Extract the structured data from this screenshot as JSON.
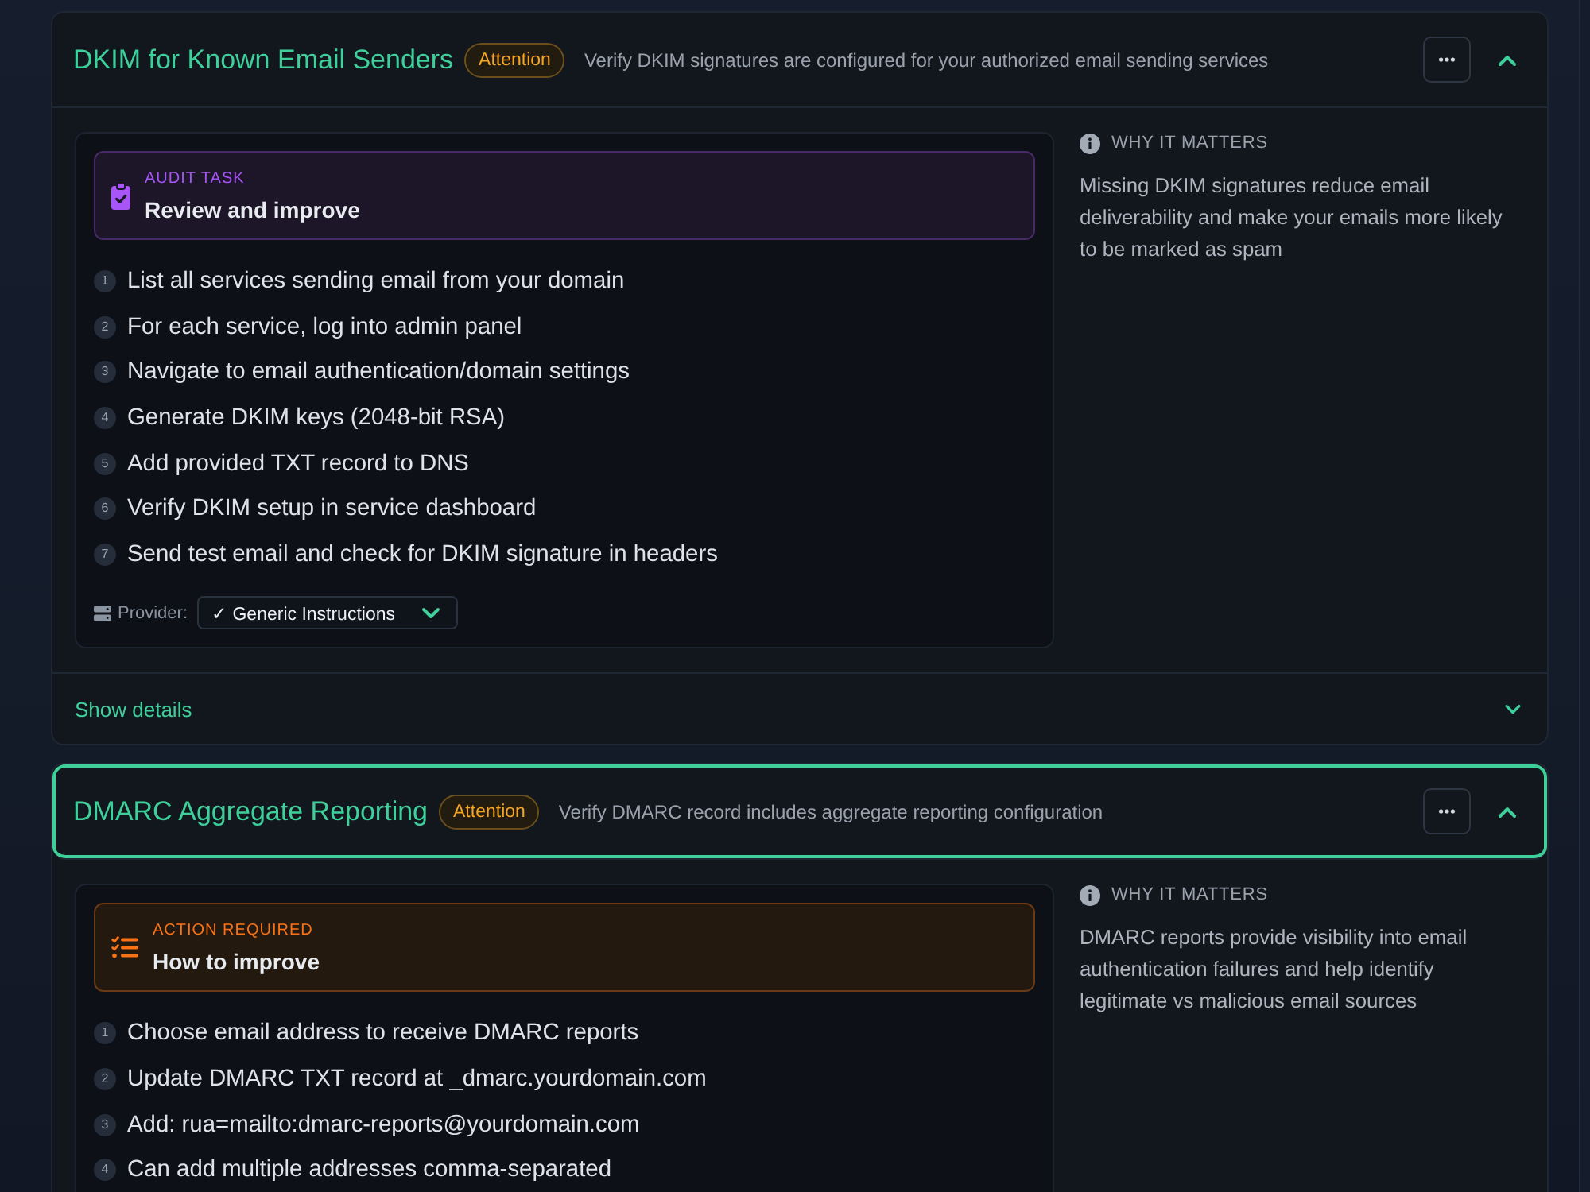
{
  "checks": [
    {
      "title": "DKIM for Known Email Senders",
      "badge": "Attention",
      "description": "Verify DKIM signatures are configured for your authorized email sending services",
      "focused": false,
      "expanded": true,
      "task": {
        "kind": "audit",
        "label": "AUDIT TASK",
        "title": "Review and improve"
      },
      "steps": [
        {
          "number": "1",
          "text": "List all services sending email from your domain"
        },
        {
          "number": "2",
          "text": "For each service, log into admin panel"
        },
        {
          "number": "3",
          "text": "Navigate to email authentication/domain settings"
        },
        {
          "number": "4",
          "text": "Generate DKIM keys (2048-bit RSA)"
        },
        {
          "number": "5",
          "text": "Add provided TXT record to DNS"
        },
        {
          "number": "6",
          "text": "Verify DKIM setup in service dashboard"
        },
        {
          "number": "7",
          "text": "Send test email and check for DKIM signature in headers"
        }
      ],
      "provider": {
        "label": "Provider:",
        "value": "✓ Generic Instructions"
      },
      "why": {
        "heading": "WHY IT MATTERS",
        "text": "Missing DKIM signatures reduce email deliverability and make your emails more likely to be marked as spam"
      },
      "details_link": "Show details"
    },
    {
      "title": "DMARC Aggregate Reporting",
      "badge": "Attention",
      "description": "Verify DMARC record includes aggregate reporting configuration",
      "focused": true,
      "expanded": true,
      "task": {
        "kind": "action",
        "label": "ACTION REQUIRED",
        "title": "How to improve"
      },
      "steps": [
        {
          "number": "1",
          "text": "Choose email address to receive DMARC reports"
        },
        {
          "number": "2",
          "text": "Update DMARC TXT record at _dmarc.yourdomain.com"
        },
        {
          "number": "3",
          "text": "Add: rua=mailto:dmarc-reports@yourdomain.com"
        },
        {
          "number": "4",
          "text": "Can add multiple addresses comma-separated"
        }
      ],
      "why": {
        "heading": "WHY IT MATTERS",
        "text": "DMARC reports provide visibility into email authentication failures and help identify legitimate vs malicious email sources"
      }
    }
  ]
}
